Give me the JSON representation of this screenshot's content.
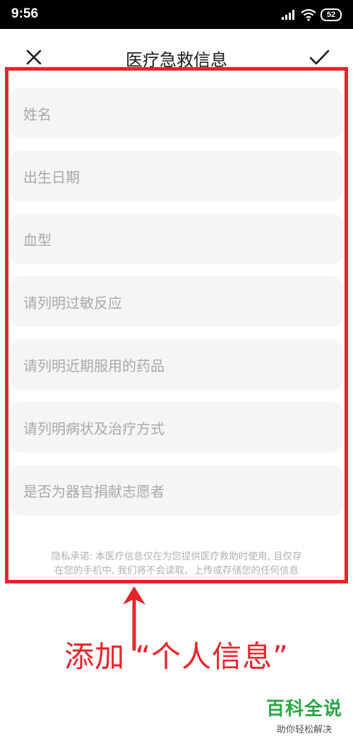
{
  "status_bar": {
    "time": "9:56",
    "battery": "52",
    "signal_icon": "signal-icon",
    "wifi_icon": "wifi-icon"
  },
  "nav": {
    "title": "医疗急救信息",
    "close_icon": "close-icon",
    "confirm_icon": "checkmark-icon"
  },
  "form": {
    "fields": [
      {
        "placeholder": "姓名"
      },
      {
        "placeholder": "出生日期"
      },
      {
        "placeholder": "血型"
      },
      {
        "placeholder": "请列明过敏反应"
      },
      {
        "placeholder": "请列明近期服用的药品"
      },
      {
        "placeholder": "请列明病状及治疗方式"
      },
      {
        "placeholder": "是否为器官捐献志愿者"
      }
    ],
    "privacy_line1": "隐私承诺: 本医疗信息仅在为您提供医疗救助时使用, 且仅存",
    "privacy_line2": "在您的手机中, 我们将不会读取、上传或存储您的任何信息"
  },
  "annotation": {
    "text": "添加 “个人信息”",
    "color": "#e8232a",
    "arrow_icon": "arrow-up-icon"
  },
  "watermark": {
    "title": "百科全说",
    "subtitle": "助你轻松解决",
    "color": "#28a745"
  }
}
